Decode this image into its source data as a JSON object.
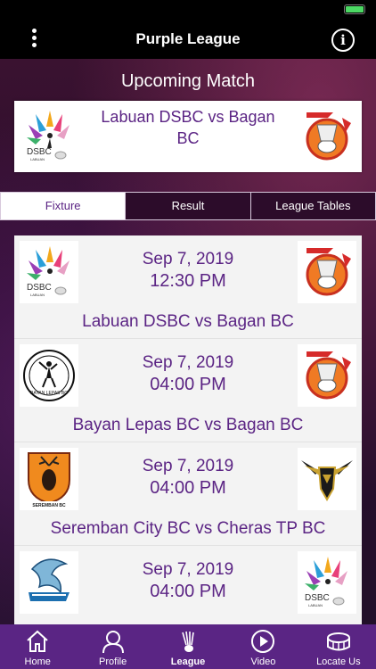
{
  "app": {
    "title": "Purple League"
  },
  "upcoming": {
    "heading": "Upcoming Match",
    "match": "Labuan DSBC vs Bagan BC",
    "home_logo": "dsbc-labuan-logo",
    "away_logo": "bagan-bc-logo",
    "home_logo_text": "DSBC",
    "home_logo_subtext": "LABUAN"
  },
  "tabs": [
    {
      "label": "Fixture",
      "active": true
    },
    {
      "label": "Result",
      "active": false
    },
    {
      "label": "League Tables",
      "active": false
    }
  ],
  "fixtures": [
    {
      "date": "Sep 7, 2019",
      "time": "12:30 PM",
      "teams": "Labuan DSBC vs Bagan BC",
      "home_logo": "dsbc-labuan-logo",
      "away_logo": "bagan-bc-logo",
      "home_logo_text": "DSBC",
      "home_logo_subtext": "LABUAN"
    },
    {
      "date": "Sep 7, 2019",
      "time": "04:00 PM",
      "teams": "Bayan Lepas BC vs Bagan BC",
      "home_logo": "bayan-lepas-bc-logo",
      "away_logo": "bagan-bc-logo",
      "home_logo_text": "BAYAN LEPAS BC"
    },
    {
      "date": "Sep 7, 2019",
      "time": "04:00 PM",
      "teams": "Seremban City BC vs Cheras TP BC",
      "home_logo": "seremban-bc-logo",
      "away_logo": "cheras-tp-bc-logo",
      "home_logo_text": "SEREMBAN BC"
    },
    {
      "date": "Sep 7, 2019",
      "time": "04:00 PM",
      "teams": "",
      "home_logo": "sigmaw-logo",
      "away_logo": "dsbc-labuan-logo",
      "away_logo_text": "DSBC",
      "away_logo_subtext": "LABUAN"
    }
  ],
  "nav": [
    {
      "label": "Home",
      "icon": "home-icon",
      "active": false
    },
    {
      "label": "Profile",
      "icon": "profile-icon",
      "active": false
    },
    {
      "label": "League",
      "icon": "shuttlecock-icon",
      "active": true
    },
    {
      "label": "Video",
      "icon": "play-icon",
      "active": false
    },
    {
      "label": "Locate Us",
      "icon": "stadium-icon",
      "active": false
    }
  ],
  "colors": {
    "brand": "#5a2584",
    "text_accent": "#5b2484",
    "bar": "#000000"
  }
}
